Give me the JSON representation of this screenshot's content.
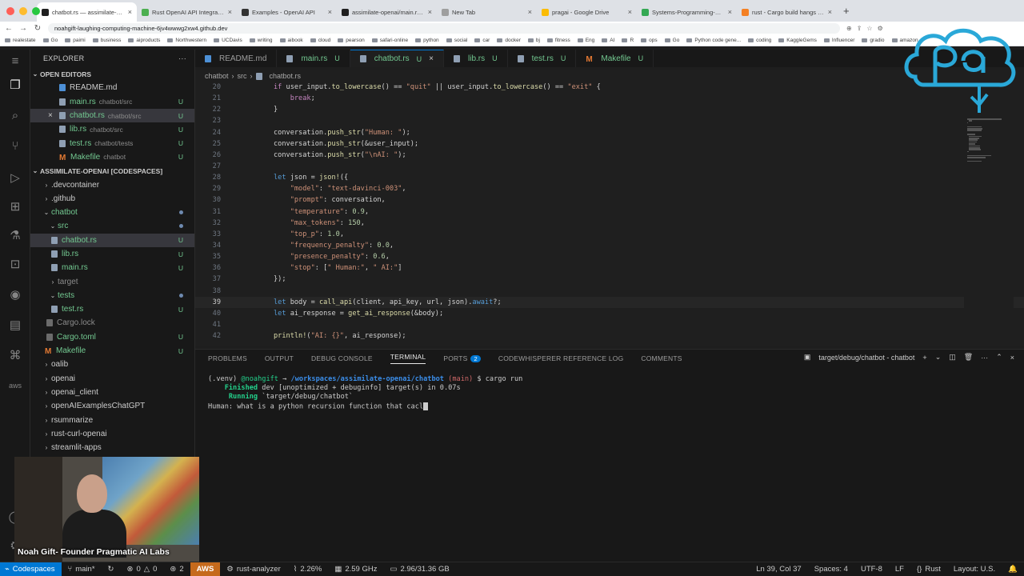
{
  "browser": {
    "tabs": [
      {
        "label": "chatbot.rs — assimilate-openai",
        "active": true
      },
      {
        "label": "Rust OpenAI API Integration",
        "active": false
      },
      {
        "label": "Examples - OpenAI API",
        "active": false
      },
      {
        "label": "assimilate-openai/main.rs at m",
        "active": false
      },
      {
        "label": "New Tab",
        "active": false
      },
      {
        "label": "pragai - Google Drive",
        "active": false
      },
      {
        "label": "Systems-Programming-Course",
        "active": false
      },
      {
        "label": "rust - Cargo build hangs with",
        "active": false
      }
    ],
    "url": "noahgift-laughing-computing-machine-6jv4wwwg2xw4.github.dev",
    "bookmarks": [
      "realestate",
      "Go",
      "paimi",
      "business",
      "aiproducts",
      "Northwestern",
      "UCDavis",
      "writing",
      "aibook",
      "cloud",
      "pearson",
      "safari-online",
      "python",
      "social",
      "car",
      "docker",
      "bj",
      "fitness",
      "Eng",
      "AI",
      "R",
      "ops",
      "Go",
      "Python code gene...",
      "coding",
      "KaggleGems",
      "Influencer",
      "gradio",
      "amazon"
    ]
  },
  "explorer": {
    "title": "EXPLORER",
    "open_editors_label": "OPEN EDITORS",
    "open_editors": [
      {
        "name": "README.md",
        "desc": "",
        "badge": ""
      },
      {
        "name": "main.rs",
        "desc": "chatbot/src",
        "badge": "U"
      },
      {
        "name": "chatbot.rs",
        "desc": "chatbot/src",
        "badge": "U"
      },
      {
        "name": "lib.rs",
        "desc": "chatbot/src",
        "badge": "U"
      },
      {
        "name": "test.rs",
        "desc": "chatbot/tests",
        "badge": "U"
      },
      {
        "name": "Makefile",
        "desc": "chatbot",
        "badge": "U"
      }
    ],
    "workspace_label": "ASSIMILATE-OPENAI [CODESPACES]",
    "tree": [
      {
        "name": ".devcontainer"
      },
      {
        "name": ".github"
      },
      {
        "name": "chatbot"
      },
      {
        "name": "src"
      },
      {
        "name": "chatbot.rs",
        "badge": "U"
      },
      {
        "name": "lib.rs",
        "badge": "U"
      },
      {
        "name": "main.rs",
        "badge": "U"
      },
      {
        "name": "target"
      },
      {
        "name": "tests"
      },
      {
        "name": "test.rs",
        "badge": "U"
      },
      {
        "name": "Cargo.lock"
      },
      {
        "name": "Cargo.toml",
        "badge": "U"
      },
      {
        "name": "Makefile",
        "badge": "U"
      },
      {
        "name": "oalib"
      },
      {
        "name": "openai"
      },
      {
        "name": "openai_client"
      },
      {
        "name": "openAIExamplesChatGPT"
      },
      {
        "name": "rsummarize"
      },
      {
        "name": "rust-curl-openai"
      },
      {
        "name": "streamlit-apps"
      }
    ]
  },
  "editor": {
    "tabs": [
      {
        "label": "README.md",
        "badge": ""
      },
      {
        "label": "main.rs",
        "badge": "U"
      },
      {
        "label": "chatbot.rs",
        "badge": "U"
      },
      {
        "label": "lib.rs",
        "badge": "U"
      },
      {
        "label": "test.rs",
        "badge": "U"
      },
      {
        "label": "Makefile",
        "badge": "U"
      }
    ],
    "breadcrumb": [
      "chatbot",
      "src",
      "chatbot.rs"
    ],
    "lines": [
      {
        "n": "20",
        "text": "if user_input.to_lowercase() == \"quit\" || user_input.to_lowercase() == \"exit\" {"
      },
      {
        "n": "21",
        "text": "    break;"
      },
      {
        "n": "22",
        "text": "}"
      },
      {
        "n": "23",
        "text": ""
      },
      {
        "n": "24",
        "text": "conversation.push_str(\"Human: \");"
      },
      {
        "n": "25",
        "text": "conversation.push_str(&user_input);"
      },
      {
        "n": "26",
        "text": "conversation.push_str(\"\\nAI: \");"
      },
      {
        "n": "27",
        "text": ""
      },
      {
        "n": "28",
        "text": "let json = json!({"
      },
      {
        "n": "29",
        "text": "    \"model\": \"text-davinci-003\","
      },
      {
        "n": "30",
        "text": "    \"prompt\": conversation,"
      },
      {
        "n": "31",
        "text": "    \"temperature\": 0.9,"
      },
      {
        "n": "32",
        "text": "    \"max_tokens\": 150,"
      },
      {
        "n": "33",
        "text": "    \"top_p\": 1.0,"
      },
      {
        "n": "34",
        "text": "    \"frequency_penalty\": 0.0,"
      },
      {
        "n": "35",
        "text": "    \"presence_penalty\": 0.6,"
      },
      {
        "n": "36",
        "text": "    \"stop\": [\" Human:\", \" AI:\"]"
      },
      {
        "n": "37",
        "text": "});"
      },
      {
        "n": "38",
        "text": ""
      },
      {
        "n": "39",
        "text": "let body = call_api(client, api_key, url, json).await?;"
      },
      {
        "n": "40",
        "text": "let ai_response = get_ai_response(&body);"
      },
      {
        "n": "41",
        "text": ""
      },
      {
        "n": "42",
        "text": "println!(\"AI: {}\", ai_response);"
      }
    ]
  },
  "panel": {
    "tabs": [
      "PROBLEMS",
      "OUTPUT",
      "DEBUG CONSOLE",
      "TERMINAL",
      "PORTS",
      "CODEWHISPERER REFERENCE LOG",
      "COMMENTS"
    ],
    "ports_count": "2",
    "terminal_name": "target/debug/chatbot - chatbot",
    "terminal": {
      "venv": "(.venv)",
      "user": "@noahgift",
      "arrow": "→",
      "path": "/workspaces/assimilate-openai/chatbot",
      "branch": "(main)",
      "command": "$ cargo run",
      "finished_kw": "Finished",
      "finished_rest": "dev [unoptimized + debuginfo] target(s) in 0.07s",
      "running_kw": "Running",
      "running_rest": "`target/debug/chatbot`",
      "human_line": "Human: what is a python recursion function that cacl"
    }
  },
  "statusbar": {
    "remote": "Codespaces",
    "branch": "main*",
    "errors": "0",
    "warnings": "0",
    "ports": "2",
    "aws": "AWS",
    "analyzer": "rust-analyzer",
    "cpu": "2.26%",
    "freq": "2.59 GHz",
    "mem": "2.96/31.36 GB",
    "position": "Ln 39, Col 37",
    "spaces": "Spaces: 4",
    "encoding": "UTF-8",
    "eol": "LF",
    "language": "Rust",
    "layout": "Layout: U.S."
  },
  "webcam": {
    "caption": "Noah Gift- Founder Pragmatic AI Labs"
  },
  "colors": {
    "accent": "#0078d4",
    "untracked": "#73c991",
    "aws": "#c56a1c",
    "logo": "#2aa8d8"
  }
}
